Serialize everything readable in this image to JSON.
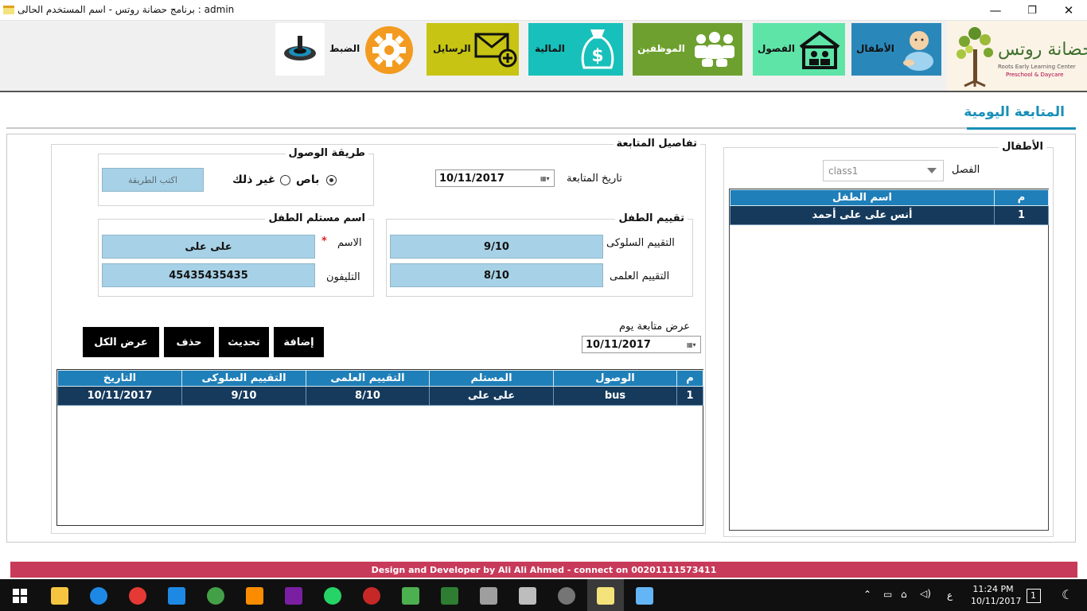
{
  "window": {
    "title": "برنامج حضانة روتس   -  اسم المستخدم الحالى  :  admin",
    "minimize_glyph": "—",
    "maximize_glyph": "❐",
    "close_glyph": "✕"
  },
  "ribbon": {
    "buttons": [
      {
        "id": "children",
        "label": "الأطفال",
        "color": "#2a87b9",
        "icon": "baby-icon"
      },
      {
        "id": "classes",
        "label": "الفصول",
        "color": "#5ee4a7",
        "icon": "school-house-icon"
      },
      {
        "id": "employees",
        "label": "الموظفين",
        "color": "#6ea02f",
        "icon": "people-group-icon"
      },
      {
        "id": "finance",
        "label": "المالية",
        "color": "#17c0bb",
        "icon": "money-bag-icon"
      },
      {
        "id": "messages",
        "label": "الرسايل",
        "color": "#c7c413",
        "icon": "envelope-add-icon"
      },
      {
        "id": "settings",
        "label": "الضبط",
        "color": "#f39b20",
        "icon": "gear-icon"
      }
    ],
    "logo": {
      "name": "حضانة روتس",
      "sub1": "Roots Early Learning Center",
      "sub2": "Preschool & Daycare"
    }
  },
  "page": {
    "title": "المتابعة اليومية"
  },
  "children_panel": {
    "title": "الأطفال",
    "class_label": "الفصل",
    "class_value": "class1",
    "columns": [
      "م",
      "اسم الطفل"
    ],
    "rows": [
      {
        "num": "1",
        "name": "أنس على على أحمد"
      }
    ]
  },
  "details": {
    "title": "تفاصيل المتابعة",
    "date_label": "تاريخ المتابعة",
    "date_value": "10/11/2017",
    "arrival": {
      "title": "طريقة الوصول",
      "option_bus": "باص",
      "option_other": "غير ذلك",
      "selected": "bus",
      "other_placeholder": "اكتب الطريقة"
    },
    "evaluation": {
      "title": "تقييم الطفل",
      "behavior_label": "التقييم السلوكى",
      "behavior_value": "9/10",
      "academic_label": "التقييم العلمى",
      "academic_value": "8/10"
    },
    "receiver": {
      "title": "اسم مستلم الطفل",
      "name_label": "الاسم",
      "required_mark": "*",
      "name_value": "على على",
      "phone_label": "التليفون",
      "phone_value": "45435435435"
    },
    "view_day_label": "عرض متابعة يوم",
    "view_day_value": "10/11/2017",
    "buttons": {
      "add": "إضافة",
      "update": "تحديث",
      "delete": "حذف",
      "show_all": "عرض الكل"
    },
    "table": {
      "columns": [
        "م",
        "الوصول",
        "المستلم",
        "التقييم العلمى",
        "التقييم السلوكى",
        "التاريخ"
      ],
      "rows": [
        {
          "num": "1",
          "arrival": "bus",
          "receiver": "على على",
          "academic": "8/10",
          "behavior": "9/10",
          "date": "10/11/2017"
        }
      ]
    }
  },
  "footer": {
    "text": "Design and Developer by Ali Ali Ahmed - connect on 00201111573411"
  },
  "taskbar": {
    "time": "11:24 PM",
    "date": "10/11/2017",
    "lang": "ع",
    "notification_count": "1"
  }
}
